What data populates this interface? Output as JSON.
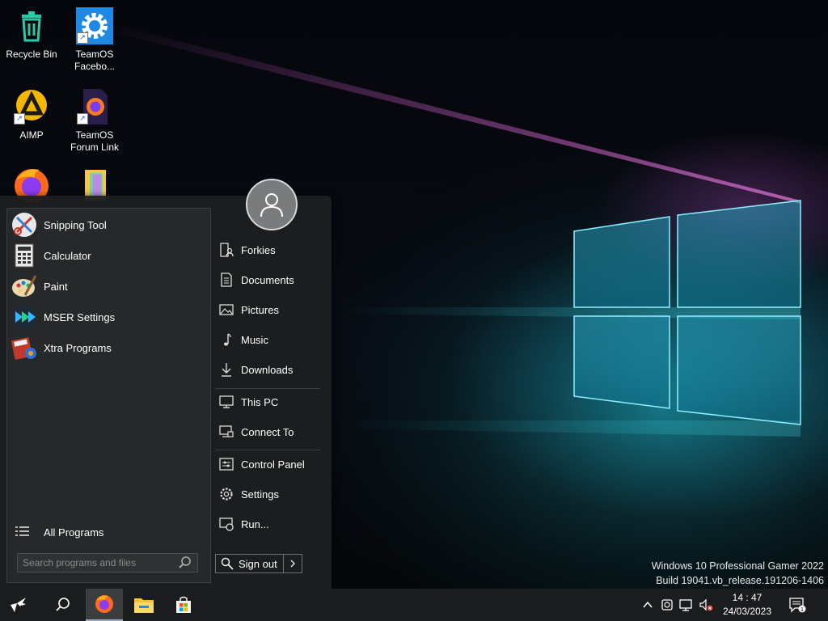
{
  "desktop": {
    "icons": [
      {
        "label": "Recycle Bin"
      },
      {
        "label": "TeamOS Facebo..."
      },
      {
        "label": "AIMP"
      },
      {
        "label": "TeamOS Forum Link"
      },
      {
        "label": ""
      },
      {
        "label": ""
      }
    ]
  },
  "start_menu": {
    "programs": [
      {
        "label": "Snipping Tool",
        "icon": "snipping-tool-icon"
      },
      {
        "label": "Calculator",
        "icon": "calculator-icon"
      },
      {
        "label": "Paint",
        "icon": "paint-icon"
      },
      {
        "label": "MSER Settings",
        "icon": "mser-settings-icon"
      },
      {
        "label": "Xtra Programs",
        "icon": "xtra-programs-icon"
      }
    ],
    "all_programs_label": "All Programs",
    "search_placeholder": "Search programs and files",
    "places": [
      {
        "label": "Forkies",
        "icon": "user-folder-icon"
      },
      {
        "label": "Documents",
        "icon": "documents-icon"
      },
      {
        "label": "Pictures",
        "icon": "pictures-icon"
      },
      {
        "label": "Music",
        "icon": "music-icon"
      },
      {
        "label": "Downloads",
        "icon": "downloads-icon"
      },
      {
        "label": "This PC",
        "icon": "this-pc-icon"
      },
      {
        "label": "Connect To",
        "icon": "connect-to-icon"
      },
      {
        "label": "Control Panel",
        "icon": "control-panel-icon"
      },
      {
        "label": "Settings",
        "icon": "settings-gear-icon"
      },
      {
        "label": "Run...",
        "icon": "run-icon"
      }
    ],
    "sign_out_label": "Sign out"
  },
  "watermark": {
    "line1": "Windows 10 Professional Gamer 2022",
    "line2": "Build 19041.vb_release.191206-1406"
  },
  "taskbar": {
    "clock_time": "14 : 47",
    "clock_date": "24/03/2023"
  },
  "colors": {
    "accent": "#3a8fd1",
    "menu_bg": "#1c1e1f",
    "taskbar_bg": "#1b1c1d"
  }
}
